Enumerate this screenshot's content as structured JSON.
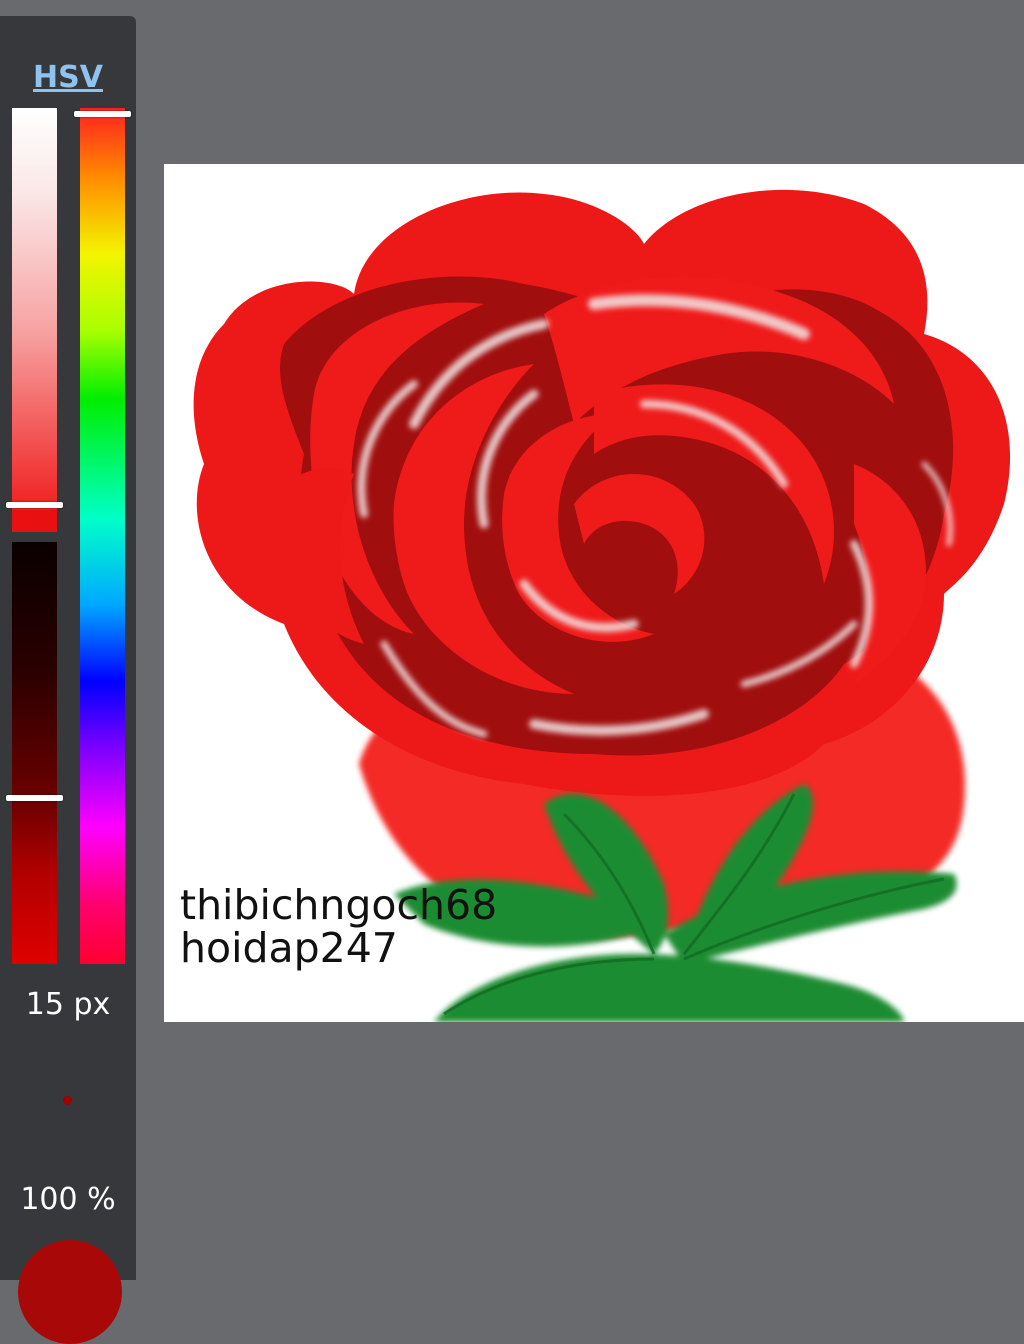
{
  "sidebar": {
    "mode_tab": "HSV",
    "brush_size": "15 px",
    "opacity": "100 %",
    "saturation_level": 0.93,
    "value_level": 0.61,
    "hue_level": 0.0
  },
  "colors": {
    "current": "#a80808",
    "background": "#686a6e",
    "panel": "#37383b",
    "tab_text": "#8fc3ef"
  },
  "canvas": {
    "signature_line1": "thibichngoch68",
    "signature_line2": "hoidap247"
  },
  "icons": [
    "brush-dot-icon",
    "color-swatch-icon"
  ]
}
